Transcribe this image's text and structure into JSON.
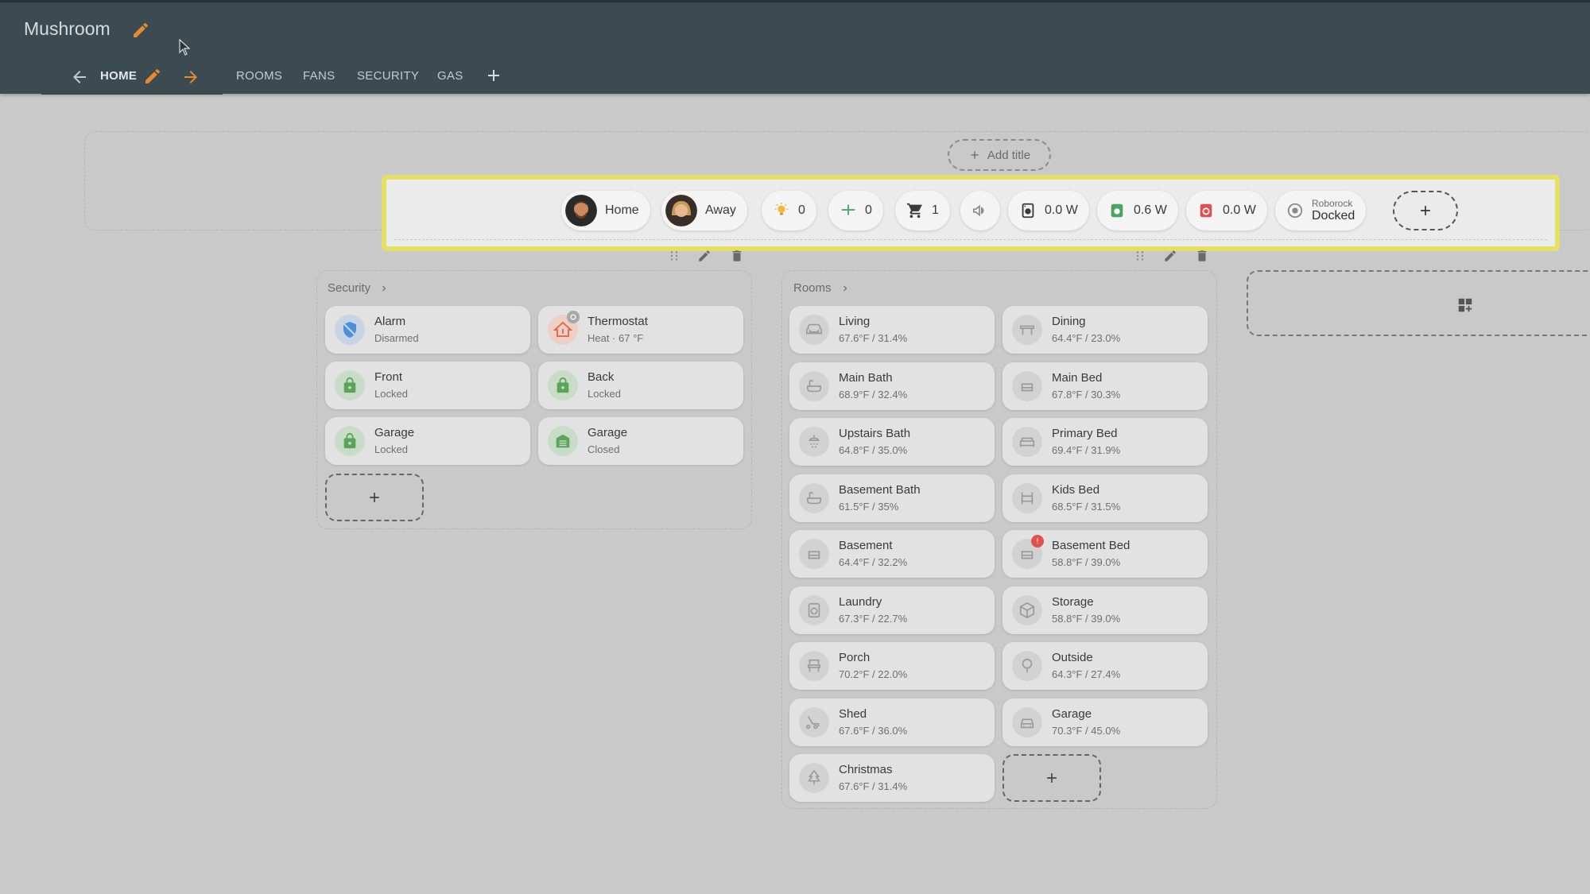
{
  "header": {
    "title": "Mushroom",
    "tabs": {
      "home": "HOME",
      "rooms": "ROOMS",
      "fans": "FANS",
      "security": "SECURITY",
      "gas": "GAS"
    }
  },
  "add_title": {
    "label": "Add title"
  },
  "chips": {
    "home": "Home",
    "away": "Away",
    "lights_count": "0",
    "fans_count": "0",
    "cart_count": "1",
    "power1": "0.0 W",
    "power2": "0.6 W",
    "power3": "0.0 W",
    "vacuum_name": "Roborock",
    "vacuum_state": "Docked"
  },
  "security": {
    "title": "Security",
    "cards": [
      {
        "name": "Alarm",
        "state": "Disarmed",
        "icon": "shield-off-icon"
      },
      {
        "name": "Thermostat",
        "state": "Heat · 67 °F",
        "icon": "home-thermostat-icon"
      },
      {
        "name": "Front",
        "state": "Locked",
        "icon": "lock-icon"
      },
      {
        "name": "Back",
        "state": "Locked",
        "icon": "lock-icon"
      },
      {
        "name": "Garage",
        "state": "Locked",
        "icon": "lock-icon"
      },
      {
        "name": "Garage",
        "state": "Closed",
        "icon": "garage-icon"
      }
    ]
  },
  "rooms": {
    "title": "Rooms",
    "cards": [
      {
        "name": "Living",
        "state": "67.6°F / 31.4%",
        "icon": "sofa-icon"
      },
      {
        "name": "Dining",
        "state": "64.4°F / 23.0%",
        "icon": "table-icon"
      },
      {
        "name": "Main Bath",
        "state": "68.9°F / 32.4%",
        "icon": "bathtub-icon"
      },
      {
        "name": "Main Bed",
        "state": "67.8°F / 30.3%",
        "icon": "bed-icon"
      },
      {
        "name": "Upstairs Bath",
        "state": "64.8°F / 35.0%",
        "icon": "shower-icon"
      },
      {
        "name": "Primary Bed",
        "state": "69.4°F / 31.9%",
        "icon": "bed-double-icon"
      },
      {
        "name": "Basement Bath",
        "state": "61.5°F / 35%",
        "icon": "bathtub-icon"
      },
      {
        "name": "Kids Bed",
        "state": "68.5°F / 31.5%",
        "icon": "bunk-bed-icon"
      },
      {
        "name": "Basement",
        "state": "64.4°F / 32.2%",
        "icon": "bed-icon"
      },
      {
        "name": "Basement Bed",
        "state": "58.8°F / 39.0%",
        "icon": "bed-icon"
      },
      {
        "name": "Laundry",
        "state": "67.3°F / 22.7%",
        "icon": "washer-icon"
      },
      {
        "name": "Storage",
        "state": "58.8°F / 39.0%",
        "icon": "package-icon"
      },
      {
        "name": "Porch",
        "state": "70.2°F / 22.0%",
        "icon": "chair-icon"
      },
      {
        "name": "Outside",
        "state": "64.3°F / 27.4%",
        "icon": "tree-icon"
      },
      {
        "name": "Shed",
        "state": "67.6°F / 36.0%",
        "icon": "mower-icon"
      },
      {
        "name": "Garage",
        "state": "70.3°F / 45.0%",
        "icon": "car-icon"
      },
      {
        "name": "Christmas",
        "state": "67.6°F / 31.4%",
        "icon": "pine-tree-icon"
      }
    ]
  },
  "colors": {
    "header_bg": "#3c4a52",
    "accent_orange": "#e88a2a",
    "highlight_yellow": "#e3e064",
    "lock_green": "#5aa55a",
    "alarm_blue": "#4a8fd8",
    "thermo_red": "#e86a4a",
    "badge_red": "#e05050"
  }
}
